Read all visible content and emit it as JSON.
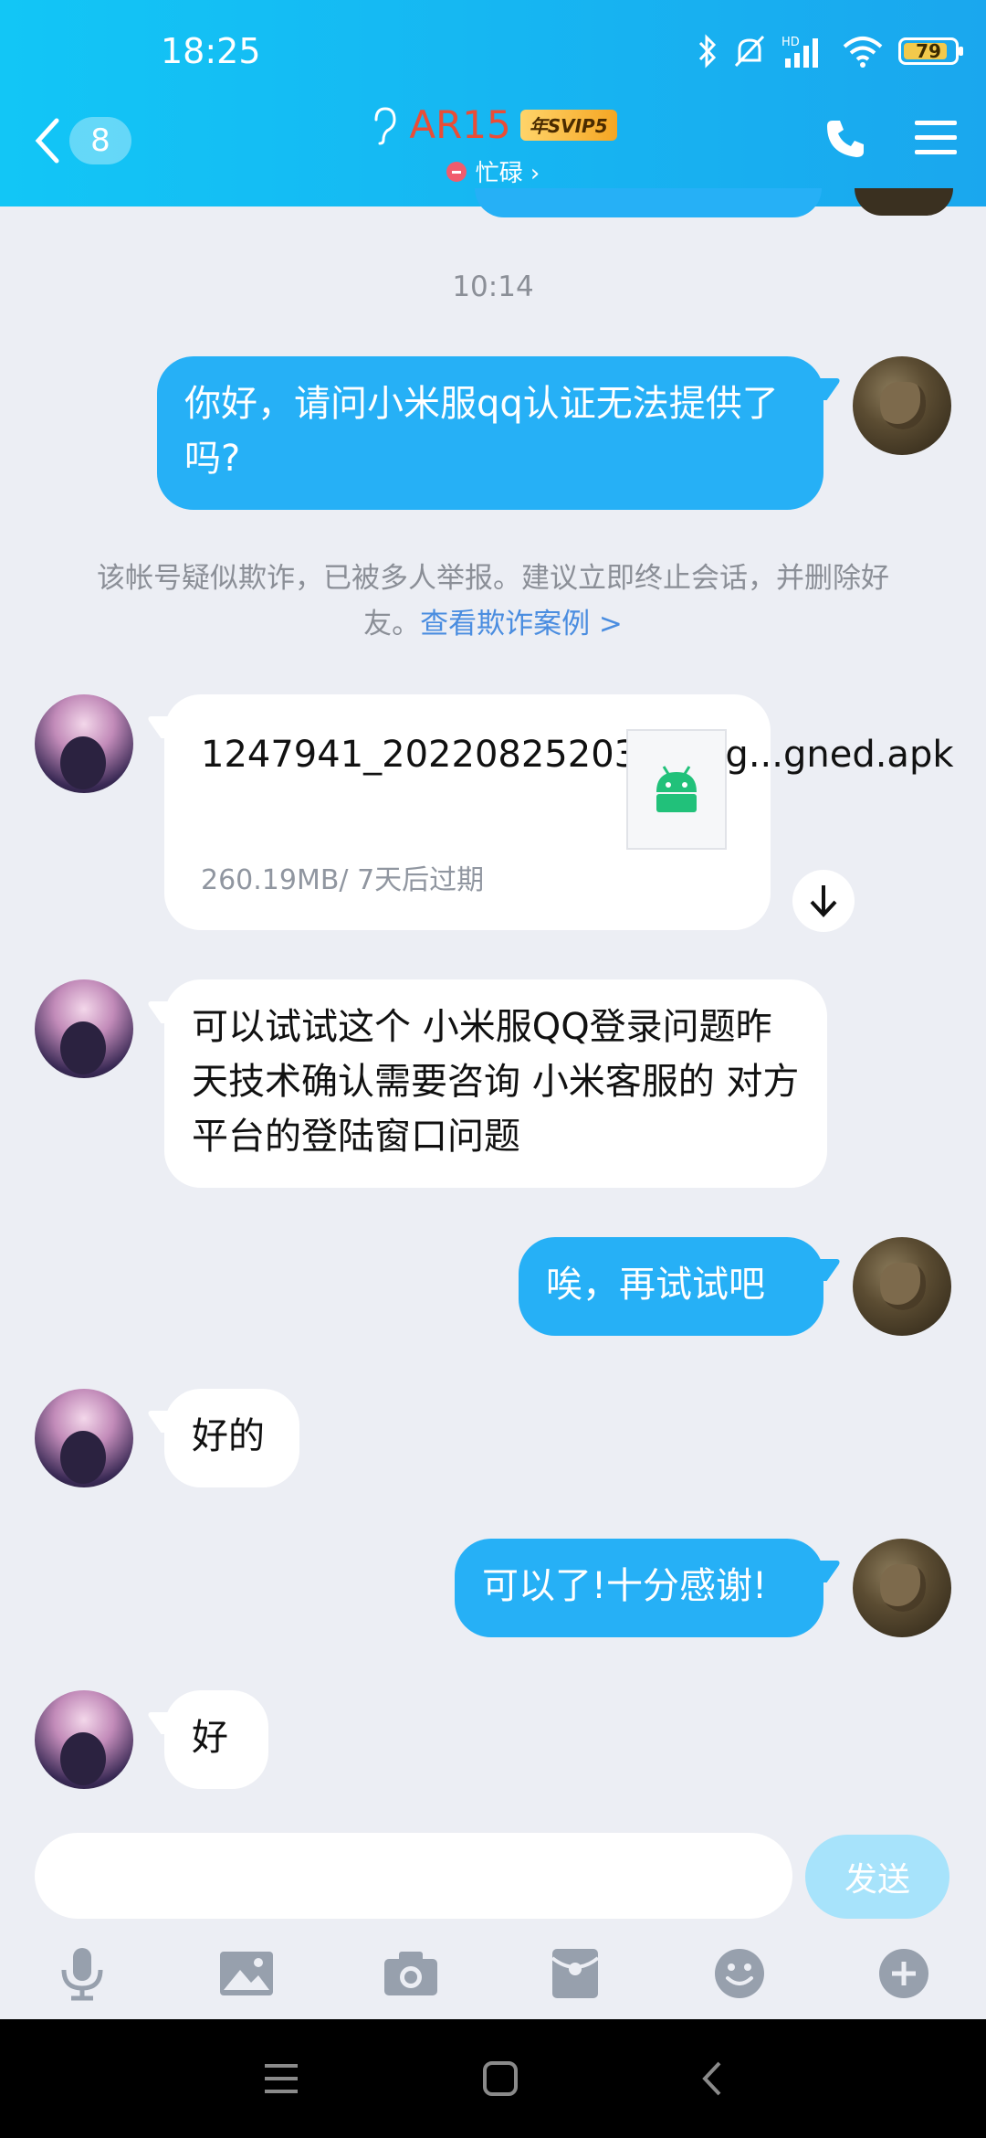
{
  "status_bar": {
    "time": "18:25",
    "battery": "79",
    "network_label": "HD"
  },
  "header": {
    "unread_count": "8",
    "contact_name": "AR15",
    "vip_badge": "年SVIP5",
    "status_text": "忙碌 ›"
  },
  "chat": {
    "timestamp": "10:14",
    "messages": [
      {
        "side": "out",
        "text": "你好，请问小米服qq认证无法提供了吗?"
      },
      {
        "side": "in",
        "type": "file",
        "file_name": "1247941_20220825203346_g...gned.apk",
        "file_meta": "260.19MB/ 7天后过期"
      },
      {
        "side": "in",
        "text": "可以试试这个   小米服QQ登录问题昨天技术确认需要咨询 小米客服的  对方平台的登陆窗口问题"
      },
      {
        "side": "out",
        "text": "唉，再试试吧"
      },
      {
        "side": "in",
        "text": "好的"
      },
      {
        "side": "out",
        "text": "可以了!十分感谢!"
      },
      {
        "side": "in",
        "text": "好"
      }
    ],
    "warning_text": "该帐号疑似欺诈，已被多人举报。建议立即终止会话，并删除好友。",
    "warning_link": "查看欺诈案例 >"
  },
  "input": {
    "placeholder": "",
    "send_label": "发送"
  },
  "toolbar_icons": [
    "mic-icon",
    "image-icon",
    "camera-icon",
    "red-packet-icon",
    "emoji-icon",
    "plus-icon"
  ],
  "colors": {
    "header_start": "#12c6f6",
    "header_end": "#1aa7ee",
    "bubble_out": "#26b0f6",
    "name": "#e94d37"
  }
}
